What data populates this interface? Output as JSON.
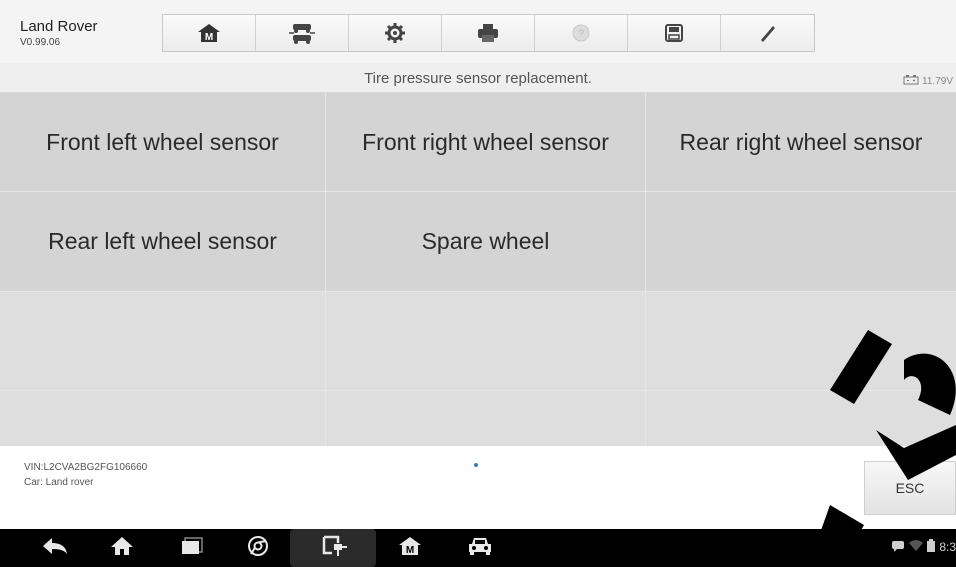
{
  "app": {
    "name": "Land Rover",
    "version": "V0.99.06"
  },
  "toolbar": [
    {
      "name": "home-icon"
    },
    {
      "name": "vehicle-swap-icon"
    },
    {
      "name": "settings-icon"
    },
    {
      "name": "print-icon"
    },
    {
      "name": "help-icon"
    },
    {
      "name": "save-icon"
    },
    {
      "name": "edit-icon"
    }
  ],
  "status": {
    "title": "Tire pressure sensor replacement.",
    "battery_voltage": "11.79V"
  },
  "grid": {
    "rows": [
      [
        "Front left wheel sensor",
        "Front right wheel sensor",
        "Rear right wheel sensor"
      ],
      [
        "Rear left wheel sensor",
        "Spare wheel",
        ""
      ],
      [
        "",
        "",
        ""
      ],
      [
        "",
        "",
        ""
      ]
    ]
  },
  "footer": {
    "vin": "VIN:L2CVA2BG2FG106660",
    "car": "Car: Land rover",
    "esc_label": "ESC"
  },
  "navbar": {
    "clock": "8:3"
  }
}
